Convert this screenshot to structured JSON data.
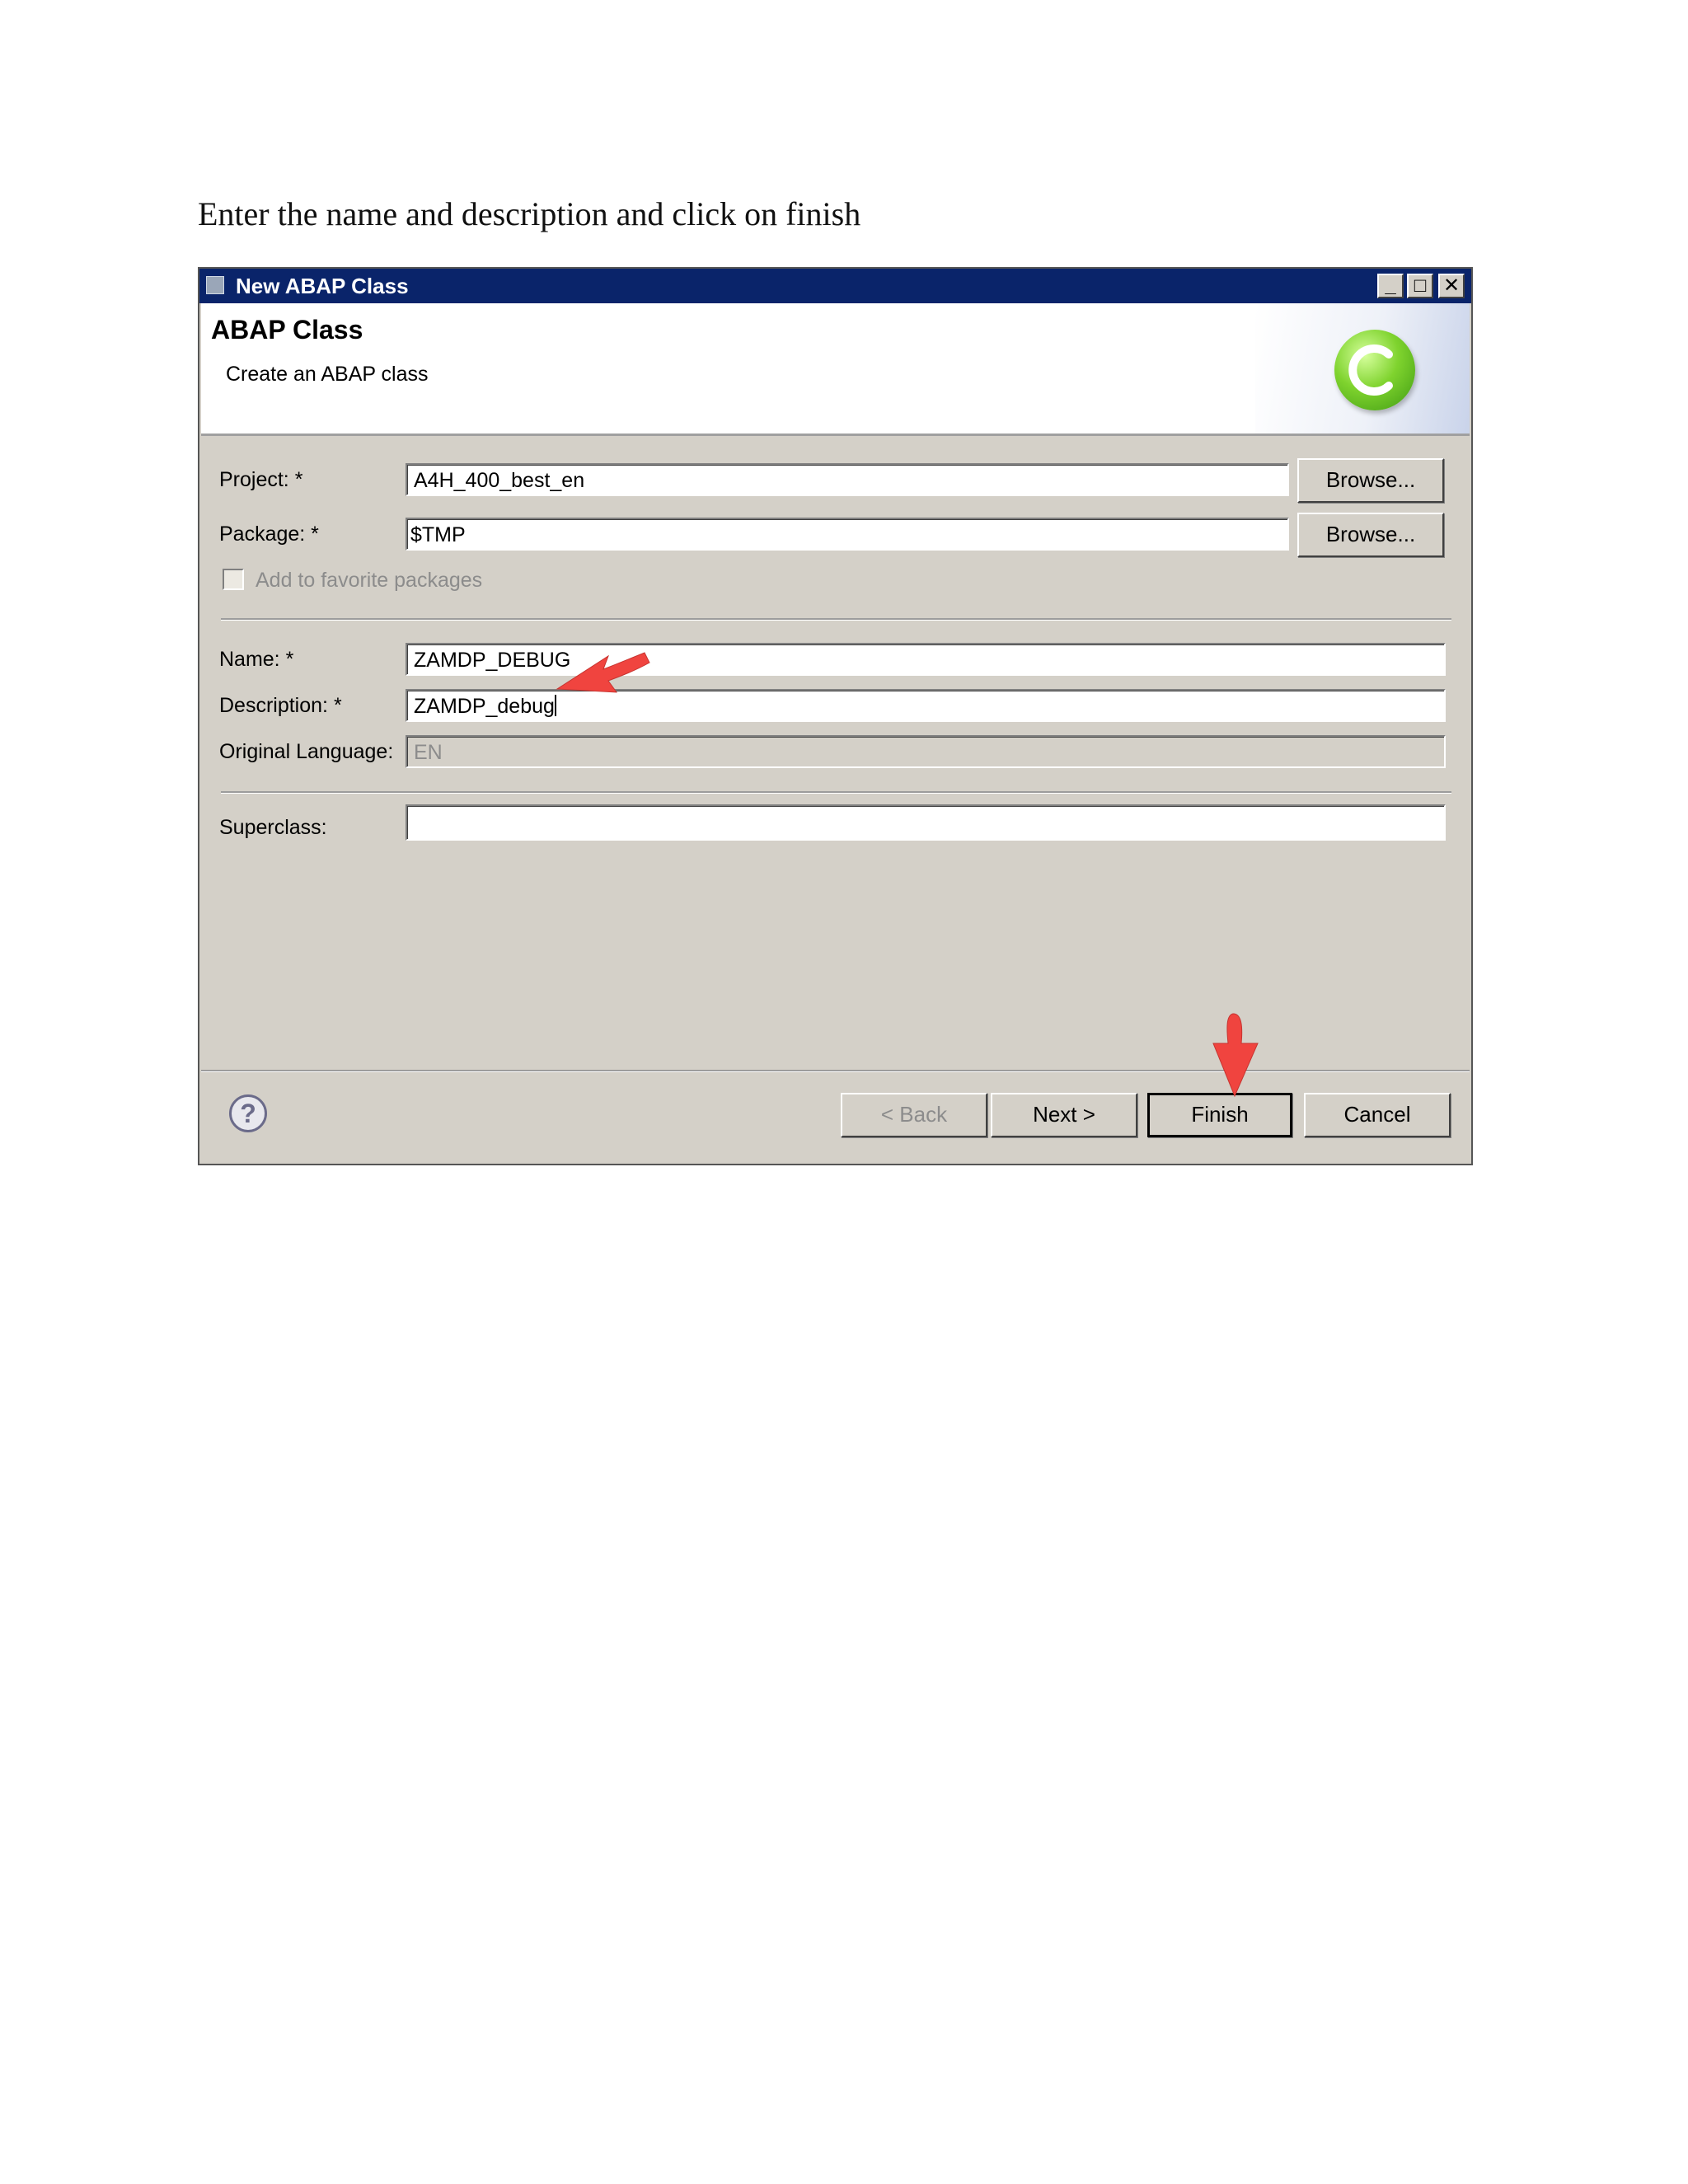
{
  "instruction": "Enter the name and description and click on finish",
  "dialog": {
    "title": "New ABAP Class",
    "header_title": "ABAP Class",
    "header_subtitle": "Create an ABAP class",
    "window_buttons": {
      "minimize": "_",
      "maximize": "□",
      "close": "✕"
    }
  },
  "form": {
    "project_label": "Project: *",
    "project_value": "A4H_400_best_en",
    "package_label": "Package: *",
    "package_value": "$TMP",
    "browse_label": "Browse...",
    "favorite_label": "Add to favorite packages",
    "name_label": "Name: *",
    "name_value": "ZAMDP_DEBUG",
    "description_label": "Description: *",
    "description_value": "ZAMDP_debug",
    "language_label": "Original Language:",
    "language_value": "EN",
    "superclass_label": "Superclass:",
    "superclass_value": ""
  },
  "buttons": {
    "help": "?",
    "back": "< Back",
    "next": "Next >",
    "finish": "Finish",
    "cancel": "Cancel"
  },
  "colors": {
    "title_bar": "#0a246a",
    "dialog_bg": "#d4d0c8",
    "arrow": "#f0443f"
  },
  "icons": {
    "header": "abap-class-c-icon",
    "help": "help-question-icon",
    "annotations": "red-pointer-arrow-icon"
  }
}
